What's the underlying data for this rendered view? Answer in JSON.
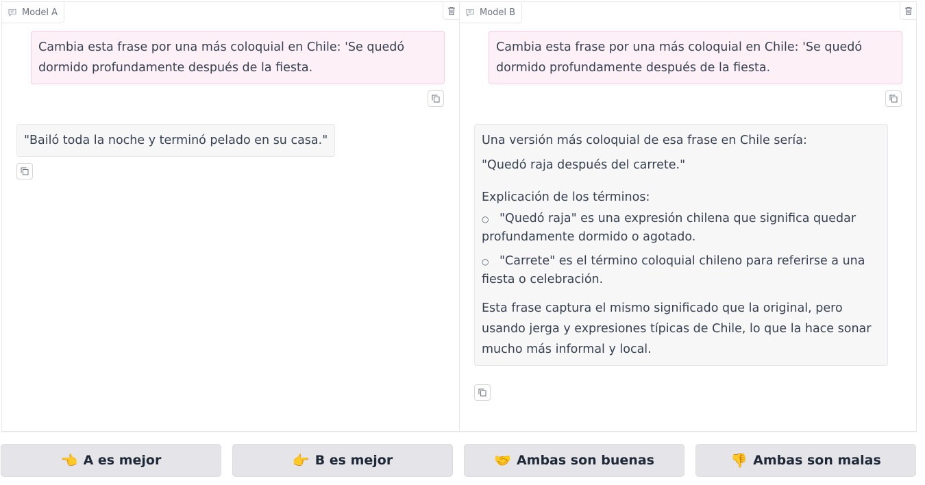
{
  "panel_a": {
    "label": "Model A",
    "user_message": "Cambia esta frase por una más coloquial en Chile: 'Se quedó dormido profundamente después de la fiesta.",
    "bot_message": "\"Bailó toda la noche y terminó pelado en su casa.\""
  },
  "panel_b": {
    "label": "Model B",
    "user_message": "Cambia esta frase por una más coloquial en Chile: 'Se quedó dormido profundamente después de la fiesta.",
    "bot_intro": "Una versión más coloquial de esa frase en Chile sería:",
    "bot_phrase": "\"Quedó raja después del carrete.\"",
    "bot_explanation_heading": "Explicación de los términos:",
    "bot_bullets": [
      "\"Quedó raja\" es una expresión chilena que significa quedar profundamente dormido o agotado.",
      "\"Carrete\" es el término coloquial chileno para referirse a una fiesta o celebración."
    ],
    "bot_conclusion": "Esta frase captura el mismo significado que la original, pero usando jerga y expresiones típicas de Chile, lo que la hace sonar mucho más informal y local."
  },
  "icons": {
    "label": "chat-bubble-icon",
    "clear": "trash-icon",
    "copy": "copy-icon",
    "bullet": "○"
  },
  "vote_buttons": [
    {
      "emoji": "👈",
      "label": "A es mejor"
    },
    {
      "emoji": "👉",
      "label": "B es mejor"
    },
    {
      "emoji": "🤝",
      "label": "Ambas son buenas"
    },
    {
      "emoji": "👎",
      "label": "Ambas son malas"
    }
  ]
}
